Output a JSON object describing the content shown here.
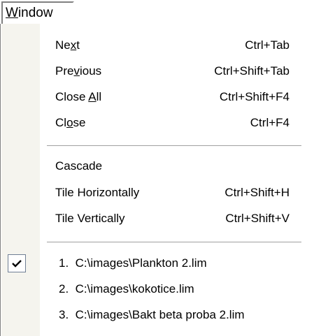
{
  "menubar": {
    "title_prefix": "",
    "title_mnemonic": "W",
    "title_rest": "indow"
  },
  "menu": {
    "group1": [
      {
        "pre": "Ne",
        "mn": "x",
        "post": "t",
        "shortcut": "Ctrl+Tab"
      },
      {
        "pre": "Pre",
        "mn": "v",
        "post": "ious",
        "shortcut": "Ctrl+Shift+Tab"
      },
      {
        "pre": "Close ",
        "mn": "A",
        "post": "ll",
        "shortcut": "Ctrl+Shift+F4"
      },
      {
        "pre": "Cl",
        "mn": "o",
        "post": "se",
        "shortcut": "Ctrl+F4"
      }
    ],
    "group2": [
      {
        "label": "Cascade",
        "shortcut": ""
      },
      {
        "label": "Tile Horizontally",
        "shortcut": "Ctrl+Shift+H"
      },
      {
        "label": "Tile Vertically",
        "shortcut": "Ctrl+Shift+V"
      }
    ],
    "recent": [
      {
        "label": "1.  C:\\images\\Plankton 2.lim",
        "checked": true
      },
      {
        "label": "2.  C:\\images\\kokotice.lim",
        "checked": false
      },
      {
        "label": "3.  C:\\images\\Bakt beta proba 2.lim",
        "checked": false
      }
    ]
  },
  "icons": {
    "check": "checkmark-icon"
  }
}
